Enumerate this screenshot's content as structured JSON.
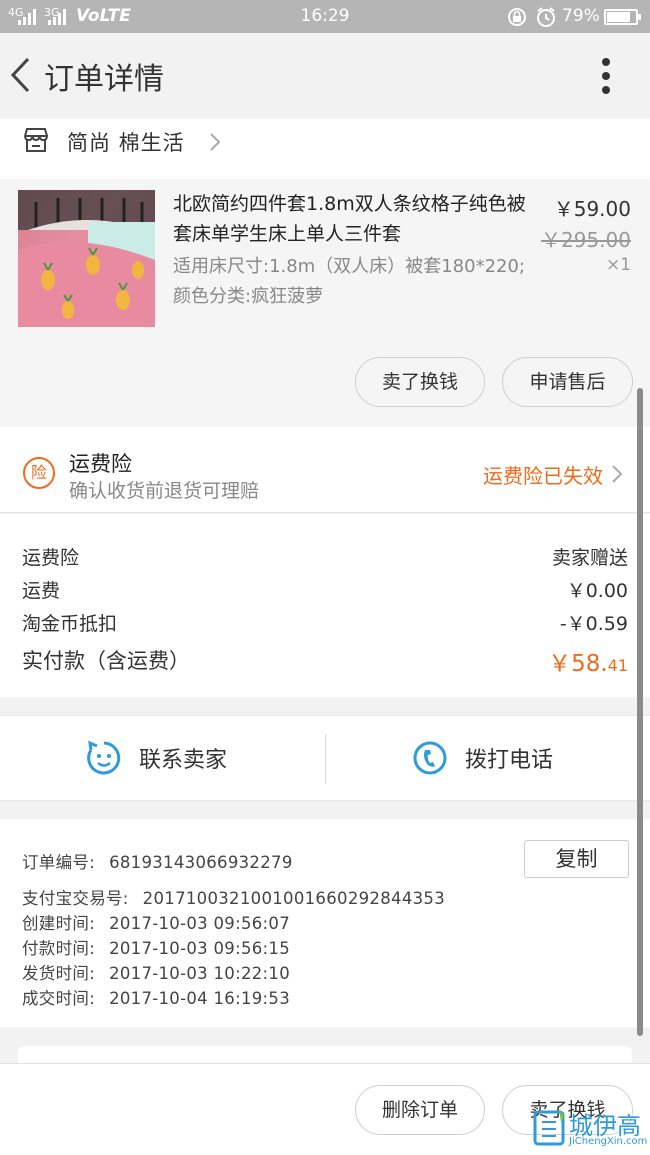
{
  "status_bar": {
    "signal_1": "4G",
    "signal_2": "3G",
    "network": "VoLTE",
    "time": "16:29",
    "battery": "79%",
    "battery_level": 0.79
  },
  "nav": {
    "title": "订单详情"
  },
  "shop": {
    "name": "简尚 棉生活"
  },
  "product": {
    "title": "北欧简约四件套1.8m双人条纹格子纯色被套床单学生床上单人三件套",
    "spec": "适用床尺寸:1.8m（双人床）被套180*220;颜色分类:疯狂菠萝",
    "price": "￥59.00",
    "original_price": "￥295.00",
    "quantity": "×1",
    "buttons": {
      "resell": "卖了换钱",
      "after_sale": "申请售后"
    }
  },
  "insurance": {
    "badge": "险",
    "title": "运费险",
    "subtitle": "确认收货前退货可理赔",
    "status": "运费险已失效"
  },
  "costs": {
    "rows": [
      {
        "label": "运费险",
        "value": "卖家赠送"
      },
      {
        "label": "运费",
        "value": "￥0.00"
      },
      {
        "label": "淘金币抵扣",
        "value": "-￥0.59"
      }
    ],
    "paid_label": "实付款（含运费）",
    "paid_value_main": "￥58.",
    "paid_value_cents": "41"
  },
  "contact": {
    "seller_label": "联系卖家",
    "phone_label": "拨打电话"
  },
  "order_info": {
    "order_no_label": "订单编号:",
    "order_no": "68193143066932279",
    "copy_label": "复制",
    "alipay_label": "支付宝交易号:",
    "alipay_no": "2017100321001001660292844353",
    "created_label": "创建时间:",
    "created": "2017-10-03 09:56:07",
    "paid_label": "付款时间:",
    "paid": "2017-10-03 09:56:15",
    "shipped_label": "发货时间:",
    "shipped": "2017-10-03 10:22:10",
    "completed_label": "成交时间:",
    "completed": "2017-10-04 16:19:53"
  },
  "bottom_bar": {
    "delete_label": "删除订单",
    "resell_label": "卖了换钱"
  },
  "watermark": {
    "cn": "城伊高",
    "en": "JiChengXin.com"
  },
  "colors": {
    "accent": "#f06a1c",
    "contact_icon": "#2f9bd8"
  }
}
